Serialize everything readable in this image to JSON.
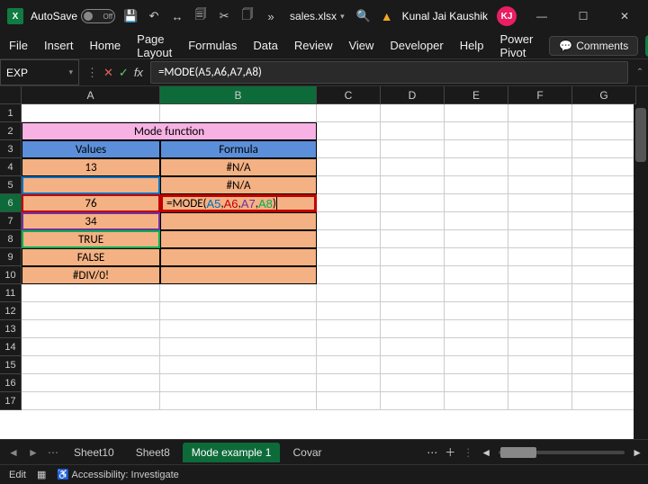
{
  "titlebar": {
    "autosave_label": "AutoSave",
    "autosave_state": "Off",
    "filename": "sales.xlsx",
    "user_name": "Kunal Jai Kaushik",
    "user_initials": "KJ"
  },
  "ribbon": {
    "tabs": [
      "File",
      "Insert",
      "Home",
      "Page Layout",
      "Formulas",
      "Data",
      "Review",
      "View",
      "Developer",
      "Help",
      "Power Pivot"
    ],
    "comments": "Comments"
  },
  "namebox": "EXP",
  "formula_bar": "=MODE(A5,A6,A7,A8)",
  "columns": [
    "A",
    "B",
    "C",
    "D",
    "E",
    "F",
    "G"
  ],
  "rows_count": 17,
  "cells": {
    "title": "Mode function",
    "hdr_values": "Values",
    "hdr_formula": "Formula",
    "A4": "13",
    "B4": "#N/A",
    "A5": "",
    "B5": "#N/A",
    "A6": "76",
    "B6_html": "=MODE(<span class='fc-blue'>A5</span>,<span class='fc-red'>A6</span>,<span class='fc-purple'>A7</span>,<span class='fc-green'>A8</span>)<span class='cursor-bar'></span>",
    "A7": "34",
    "A8": "TRUE",
    "A9": "FALSE",
    "A10": "#DIV/0!"
  },
  "sheets": {
    "items": [
      "Sheet10",
      "Sheet8",
      "Mode example 1",
      "Covar"
    ],
    "active": 2
  },
  "statusbar": {
    "mode": "Edit",
    "accessibility": "Accessibility: Investigate"
  }
}
